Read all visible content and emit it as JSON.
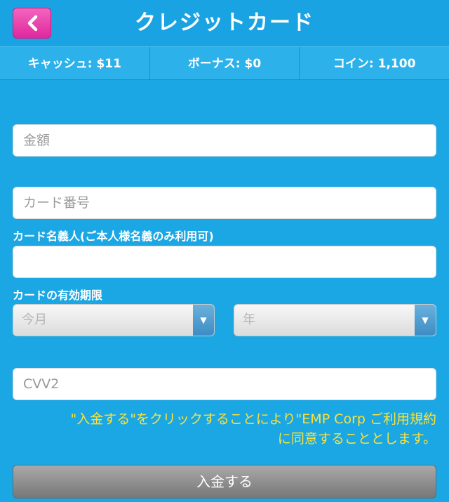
{
  "header": {
    "title": "クレジットカード",
    "back_icon": "chevron-left-icon"
  },
  "stats": [
    {
      "label": "キャッシュ: $11"
    },
    {
      "label": "ボーナス: $0"
    },
    {
      "label": "コイン: 1,100"
    }
  ],
  "form": {
    "amount": {
      "placeholder": "金額",
      "value": ""
    },
    "card_number": {
      "placeholder": "カード番号",
      "value": ""
    },
    "card_holder": {
      "label": "カード名義人(ご本人様名義のみ利用可)",
      "value": ""
    },
    "expiry": {
      "label": "カードの有効期限",
      "month": "今月",
      "year": "年"
    },
    "cvv": {
      "placeholder": "CVV2",
      "value": ""
    }
  },
  "terms": {
    "line1": "\"入金する\"をクリックすることにより\"EMP Corp ご利用規約",
    "line2": "に同意することとします。"
  },
  "submit_label": "入金する",
  "colors": {
    "background": "#1ba6e4",
    "back_button": "#e0279c",
    "terms_text": "#fbe23a"
  }
}
